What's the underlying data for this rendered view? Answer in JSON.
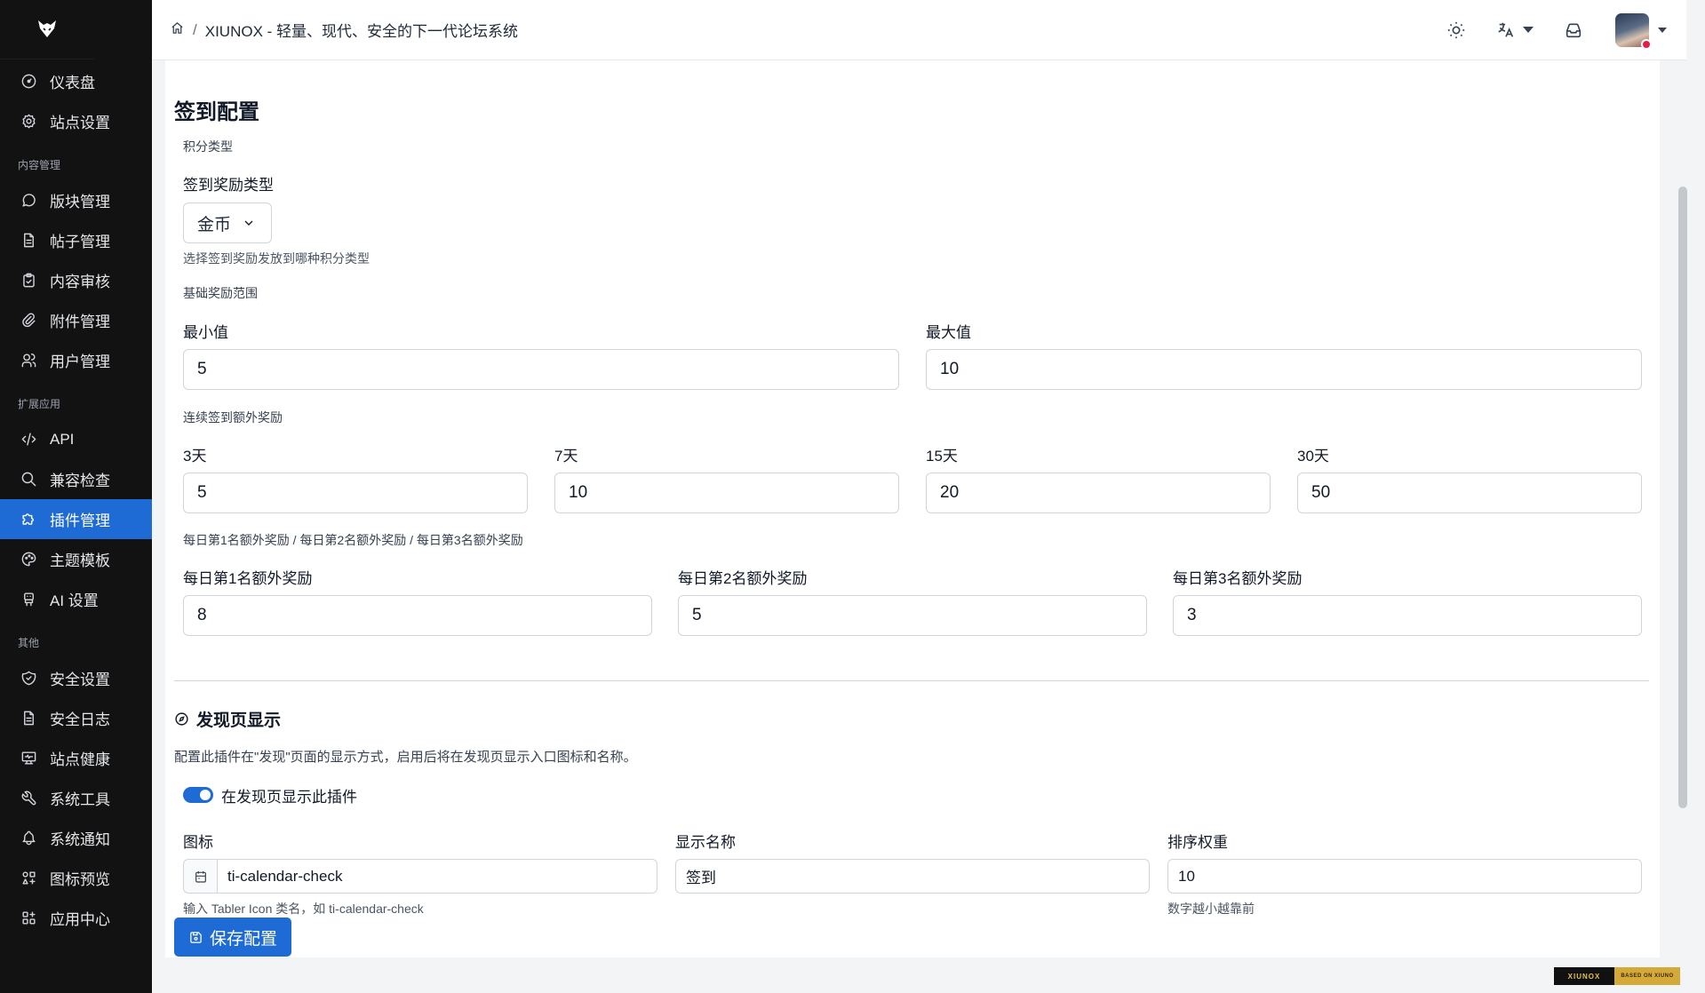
{
  "header": {
    "breadcrumb_title": "XIUNOX - 轻量、现代、安全的下一代论坛系统",
    "breadcrumb_sep": "/"
  },
  "sidebar": {
    "items_top": [
      {
        "label": "仪表盘",
        "icon": "dashboard-icon"
      },
      {
        "label": "站点设置",
        "icon": "settings-icon"
      }
    ],
    "section_content": "内容管理",
    "items_content": [
      {
        "label": "版块管理",
        "icon": "message-circle-icon"
      },
      {
        "label": "帖子管理",
        "icon": "file-text-icon"
      },
      {
        "label": "内容审核",
        "icon": "clipboard-check-icon"
      },
      {
        "label": "附件管理",
        "icon": "paperclip-icon"
      },
      {
        "label": "用户管理",
        "icon": "users-icon"
      }
    ],
    "section_ext": "扩展应用",
    "items_ext": [
      {
        "label": "API",
        "icon": "code-icon"
      },
      {
        "label": "兼容检查",
        "icon": "search-icon"
      },
      {
        "label": "插件管理",
        "icon": "puzzle-icon",
        "active": true
      },
      {
        "label": "主题模板",
        "icon": "palette-icon"
      },
      {
        "label": "AI 设置",
        "icon": "robot-icon"
      }
    ],
    "section_other": "其他",
    "items_other": [
      {
        "label": "安全设置",
        "icon": "shield-icon"
      },
      {
        "label": "安全日志",
        "icon": "file-text-icon"
      },
      {
        "label": "站点健康",
        "icon": "monitor-heart-icon"
      },
      {
        "label": "系统工具",
        "icon": "tool-icon"
      },
      {
        "label": "系统通知",
        "icon": "bell-icon"
      },
      {
        "label": "图标预览",
        "icon": "icons-icon"
      },
      {
        "label": "应用中心",
        "icon": "apps-icon"
      }
    ]
  },
  "form": {
    "title": "签到配置",
    "points_type_group": "积分类型",
    "reward_type_label": "签到奖励类型",
    "reward_type_value": "金币",
    "reward_type_help": "选择签到奖励发放到哪种积分类型",
    "base_range_group": "基础奖励范围",
    "min_label": "最小值",
    "min_value": "5",
    "max_label": "最大值",
    "max_value": "10",
    "streak_group": "连续签到额外奖励",
    "streak": [
      {
        "label": "3天",
        "value": "5"
      },
      {
        "label": "7天",
        "value": "10"
      },
      {
        "label": "15天",
        "value": "20"
      },
      {
        "label": "30天",
        "value": "50"
      }
    ],
    "rank_group": "每日第1名额外奖励 / 每日第2名额外奖励 / 每日第3名额外奖励",
    "rank": [
      {
        "label": "每日第1名额外奖励",
        "value": "8"
      },
      {
        "label": "每日第2名额外奖励",
        "value": "5"
      },
      {
        "label": "每日第3名额外奖励",
        "value": "3"
      }
    ]
  },
  "discover": {
    "title": "发现页显示",
    "description": "配置此插件在\"发现\"页面的显示方式，启用后将在发现页显示入口图标和名称。",
    "toggle_label": "在发现页显示此插件",
    "toggle_on": true,
    "icon_label": "图标",
    "icon_value": "ti-calendar-check",
    "icon_help": "输入 Tabler Icon 类名，如 ti-calendar-check",
    "name_label": "显示名称",
    "name_value": "签到",
    "sort_label": "排序权重",
    "sort_value": "10",
    "sort_help": "数字越小越靠前"
  },
  "save_button": "保存配置",
  "badge": {
    "left": "XIUNOX",
    "right": "BASED ON XIUNO"
  },
  "colors": {
    "accent": "#1f6bd6",
    "sidebar_bg": "#121212"
  }
}
